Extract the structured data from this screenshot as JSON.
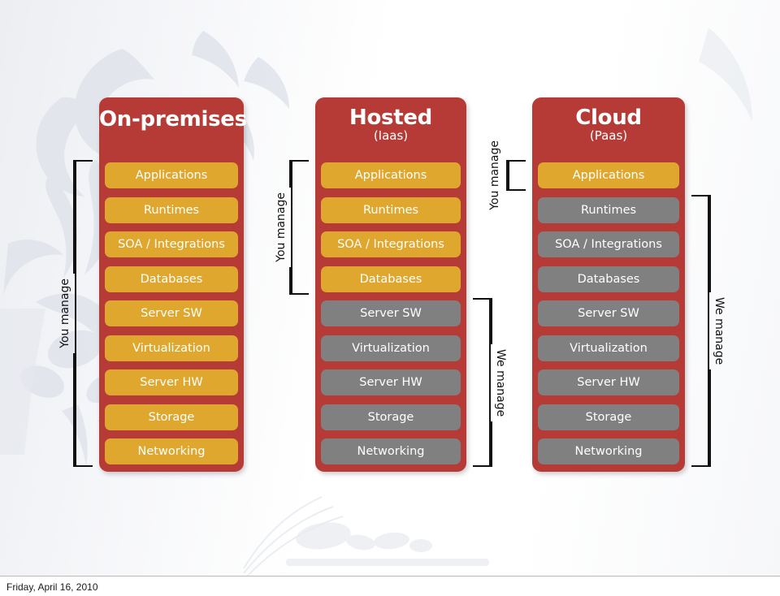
{
  "slide": {
    "footer_date": "Friday, April 16, 2010"
  },
  "colors": {
    "panel_red": "#b63b36",
    "managed_gold": "#e0a72e",
    "provider_gray": "#808080",
    "bracket_black": "#111111",
    "text_white": "#ffffff"
  },
  "labels": {
    "you_manage": "You manage",
    "we_manage": "We manage"
  },
  "layers": [
    "Applications",
    "Runtimes",
    "SOA / Integrations",
    "Databases",
    "Server SW",
    "Virtualization",
    "Server HW",
    "Storage",
    "Networking"
  ],
  "columns": [
    {
      "id": "on-premises",
      "title": "On-premises",
      "subtitle": "",
      "rows": [
        {
          "label": "Applications",
          "owner": "customer"
        },
        {
          "label": "Runtimes",
          "owner": "customer"
        },
        {
          "label": "SOA / Integrations",
          "owner": "customer"
        },
        {
          "label": "Databases",
          "owner": "customer"
        },
        {
          "label": "Server SW",
          "owner": "customer"
        },
        {
          "label": "Virtualization",
          "owner": "customer"
        },
        {
          "label": "Server HW",
          "owner": "customer"
        },
        {
          "label": "Storage",
          "owner": "customer"
        },
        {
          "label": "Networking",
          "owner": "customer"
        }
      ],
      "left_bracket": {
        "label": "You manage",
        "from_row": 1,
        "to_row": 9
      },
      "right_bracket": null
    },
    {
      "id": "hosted",
      "title": "Hosted",
      "subtitle": "(Iaas)",
      "rows": [
        {
          "label": "Applications",
          "owner": "customer"
        },
        {
          "label": "Runtimes",
          "owner": "customer"
        },
        {
          "label": "SOA / Integrations",
          "owner": "customer"
        },
        {
          "label": "Databases",
          "owner": "customer"
        },
        {
          "label": "Server SW",
          "owner": "provider"
        },
        {
          "label": "Virtualization",
          "owner": "provider"
        },
        {
          "label": "Server HW",
          "owner": "provider"
        },
        {
          "label": "Storage",
          "owner": "provider"
        },
        {
          "label": "Networking",
          "owner": "provider"
        }
      ],
      "left_bracket": {
        "label": "You manage",
        "from_row": 1,
        "to_row": 4
      },
      "right_bracket": {
        "label": "We manage",
        "from_row": 5,
        "to_row": 9
      }
    },
    {
      "id": "cloud",
      "title": "Cloud",
      "subtitle": "(Paas)",
      "rows": [
        {
          "label": "Applications",
          "owner": "customer"
        },
        {
          "label": "Runtimes",
          "owner": "provider"
        },
        {
          "label": "SOA / Integrations",
          "owner": "provider"
        },
        {
          "label": "Databases",
          "owner": "provider"
        },
        {
          "label": "Server SW",
          "owner": "provider"
        },
        {
          "label": "Virtualization",
          "owner": "provider"
        },
        {
          "label": "Server HW",
          "owner": "provider"
        },
        {
          "label": "Storage",
          "owner": "provider"
        },
        {
          "label": "Networking",
          "owner": "provider"
        }
      ],
      "left_bracket": {
        "label": "You manage",
        "from_row": 1,
        "to_row": 1
      },
      "right_bracket": {
        "label": "We manage",
        "from_row": 2,
        "to_row": 9
      }
    }
  ]
}
